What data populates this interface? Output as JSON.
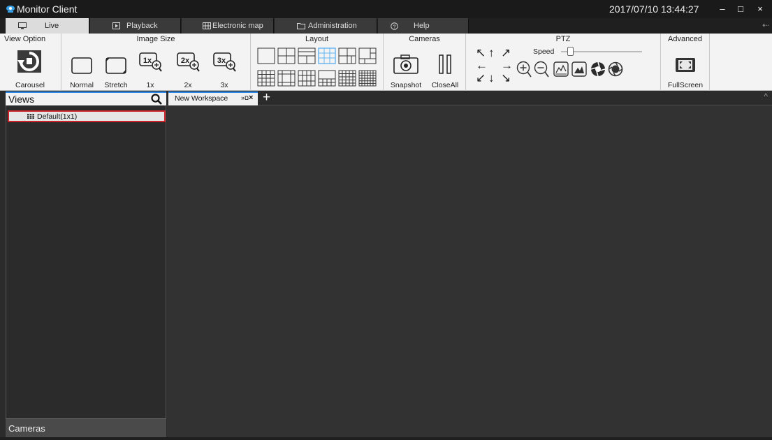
{
  "window": {
    "title": "Monitor Client",
    "clock": "2017/07/10 13:44:27",
    "minimize": "–",
    "maximize": "□",
    "close": "×"
  },
  "main_tabs": [
    {
      "label": "Live",
      "icon": "monitor-icon"
    },
    {
      "label": "Playback",
      "icon": "play-icon"
    },
    {
      "label": "Electronic map",
      "icon": "map-icon"
    },
    {
      "label": "Administration",
      "icon": "folder-icon"
    },
    {
      "label": "Help",
      "icon": "help-icon"
    }
  ],
  "ribbon": {
    "view_option": {
      "title": "View Option",
      "carousel": "Carousel"
    },
    "image_size": {
      "title": "Image Size",
      "normal": "Normal",
      "stretch": "Stretch",
      "x1": "1x",
      "x2": "2x",
      "x3": "3x",
      "x1_glyph": "1x",
      "x2_glyph": "2x",
      "x3_glyph": "3x"
    },
    "layout": {
      "title": "Layout",
      "active_index": 3
    },
    "cameras": {
      "title": "Cameras",
      "snapshot": "Snapshot",
      "close_all": "CloseAll"
    },
    "ptz": {
      "title": "PTZ",
      "speed": "Speed",
      "speed_level": 0.08,
      "arrows": [
        "↖",
        "↑",
        "↗",
        "←",
        "→",
        "↙",
        "↓",
        "↘"
      ]
    },
    "advanced": {
      "title": "Advanced",
      "fullscreen": "FullScreen"
    }
  },
  "views_panel": {
    "title": "Views",
    "items": [
      {
        "label": "Default(1x1)",
        "selected": true
      }
    ],
    "cameras_title": "Cameras"
  },
  "workspace": {
    "tabs": [
      {
        "label": "New Workspace",
        "pin": "»ם",
        "close": "×"
      }
    ],
    "add": "+",
    "collapse": "^"
  },
  "colors": {
    "accent": "#2e8ae6",
    "highlight": "#c9232a",
    "layout_active": "#63b3f0"
  }
}
